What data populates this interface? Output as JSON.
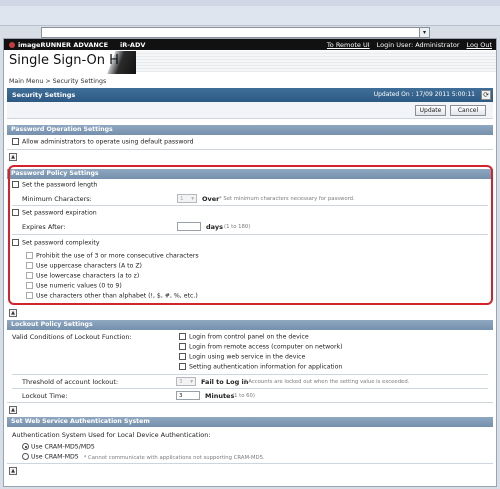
{
  "url_bar": {
    "value": ""
  },
  "header": {
    "brand": "imageRUNNER ADVANCE",
    "model": "iR-ADV",
    "links": [
      "To Remote UI",
      "Login User: Administrator",
      "Log Out"
    ],
    "title": "Single Sign-On H"
  },
  "breadcrumb": "Main Menu > Security Settings",
  "page": {
    "title": "Security Settings",
    "updated": "Updated On : 17/09 2011 5:00:11",
    "update_label": "Update",
    "cancel_label": "Cancel"
  },
  "password_operation": {
    "heading": "Password Operation Settings",
    "allow_admin": "Allow administrators to operate using default password"
  },
  "password_policy": {
    "heading": "Password Policy Settings",
    "set_length": "Set the password length",
    "min_chars_label": "Minimum Characters:",
    "min_chars_value": "1",
    "over_label": "Over",
    "min_chars_note": "* Set minimum characters necessary for password.",
    "set_expiration": "Set password expiration",
    "expires_label": "Expires After:",
    "days_label": "days",
    "days_range": "(1 to 180)",
    "set_complexity": "Set password complexity",
    "complexity_options": [
      "Prohibit the use of 3 or more consecutive characters",
      "Use uppercase characters (A to Z)",
      "Use lowercase characters (a to z)",
      "Use numeric values (0 to 9)",
      "Use characters other than alphabet (!, $, #, %, etc.)"
    ]
  },
  "lockout": {
    "heading": "Lockout Policy Settings",
    "valid_label": "Valid Conditions of Lockout Function:",
    "conditions": [
      "Login from control panel on the device",
      "Login from remote access (computer on network)",
      "Login using web service in the device",
      "Setting authentication information for application"
    ],
    "threshold_label": "Threshold of account lockout:",
    "threshold_value": "3",
    "fail_label": "Fail to Log in",
    "threshold_note": "* Accounts are locked out when the setting value is exceeded.",
    "time_label": "Lockout Time:",
    "time_value": "3",
    "minutes_label": "Minutes",
    "minutes_range": "(1 to 60)"
  },
  "web_service": {
    "heading": "Set Web Service Authentication System",
    "system_label": "Authentication System Used for Local Device Authentication:",
    "option1": "Use CRAM-MD5/MD5",
    "option2": "Use CRAM-MD5",
    "option2_note": "* Cannot communicate with applications not supporting CRAM-MD5."
  },
  "icons": {
    "collapse": "▲",
    "refresh": "⟳",
    "dropdown": "▾"
  }
}
